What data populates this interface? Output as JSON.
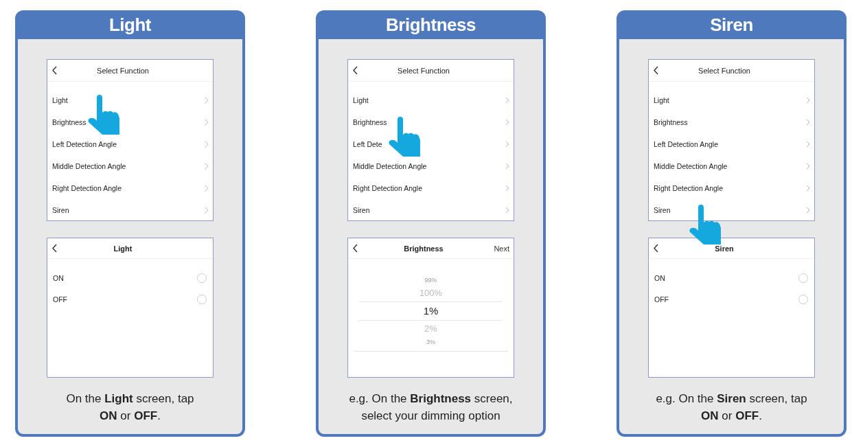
{
  "panels": [
    {
      "title": "Light",
      "menu": {
        "title": "Select Function",
        "items": [
          {
            "label": "Light",
            "tapped": true
          },
          {
            "label": "Brightness",
            "tapped": false
          },
          {
            "label": "Left Detection Angle",
            "tapped": false
          },
          {
            "label": "Middle Detection Angle",
            "tapped": false
          },
          {
            "label": "Right Detection Angle",
            "tapped": false
          },
          {
            "label": "Siren",
            "tapped": false
          }
        ]
      },
      "detail": {
        "kind": "options",
        "title": "Light",
        "options": [
          {
            "label": "ON",
            "selected": false
          },
          {
            "label": "OFF",
            "selected": false
          }
        ]
      },
      "caption": [
        "On the **Light** screen, tap",
        "**ON** or **OFF**."
      ]
    },
    {
      "title": "Brightness",
      "menu": {
        "title": "Select Function",
        "items": [
          {
            "label": "Light",
            "tapped": false
          },
          {
            "label": "Brightness",
            "tapped": true
          },
          {
            "label": "Left Dete",
            "tapped": false
          },
          {
            "label": "Middle Detection Angle",
            "tapped": false
          },
          {
            "label": "Right Detection Angle",
            "tapped": false
          },
          {
            "label": "Siren",
            "tapped": false
          }
        ]
      },
      "detail": {
        "kind": "picker",
        "title": "Brightness",
        "action": "Next",
        "values": [
          {
            "label": "99%",
            "selected": false
          },
          {
            "label": "100%",
            "selected": false
          },
          {
            "label": "1%",
            "selected": true
          },
          {
            "label": "2%",
            "selected": false
          },
          {
            "label": "3%",
            "selected": false
          }
        ]
      },
      "caption": [
        "e.g. On the **Brightness** screen,",
        "select your dimming option"
      ]
    },
    {
      "title": "Siren",
      "menu": {
        "title": "Select Function",
        "items": [
          {
            "label": "Light",
            "tapped": false
          },
          {
            "label": "Brightness",
            "tapped": false
          },
          {
            "label": "Left Detection Angle",
            "tapped": false
          },
          {
            "label": "Middle Detection Angle",
            "tapped": false
          },
          {
            "label": "Right Detection Angle",
            "tapped": false
          },
          {
            "label": "Siren",
            "tapped": true
          }
        ]
      },
      "detail": {
        "kind": "options",
        "title": "Siren",
        "options": [
          {
            "label": "ON",
            "selected": false
          },
          {
            "label": "OFF",
            "selected": false
          }
        ]
      },
      "caption": [
        "e.g. On the **Siren** screen, tap",
        "**ON** or **OFF**."
      ]
    }
  ]
}
